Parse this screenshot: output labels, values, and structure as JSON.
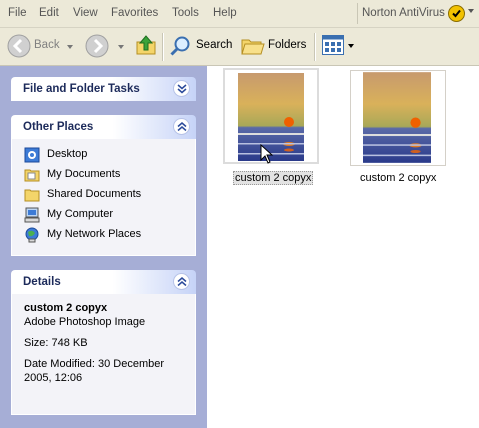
{
  "menu": {
    "items": [
      "File",
      "Edit",
      "View",
      "Favorites",
      "Tools",
      "Help"
    ],
    "norton": "Norton AntiVirus"
  },
  "toolbar": {
    "back_label": "Back",
    "search_label": "Search",
    "folders_label": "Folders"
  },
  "task_pane": {
    "file_tasks_title": "File and Folder Tasks",
    "other_places_title": "Other Places",
    "places": [
      "Desktop",
      "My Documents",
      "Shared Documents",
      "My Computer",
      "My Network Places"
    ],
    "details_title": "Details",
    "details": {
      "name": "custom 2 copyx",
      "type": "Adobe Photoshop Image",
      "size": "Size: 748 KB",
      "modified": "Date Modified: 30 December 2005, 12:06"
    }
  },
  "files": [
    {
      "name": "custom 2 copyx",
      "selected": true
    },
    {
      "name": "custom 2 copyx",
      "selected": false
    }
  ],
  "colors": {
    "taskpane_bg": "#a6aed6",
    "panel_title": "#1c2a5a",
    "toolbar_bg": "#ece9d8"
  }
}
